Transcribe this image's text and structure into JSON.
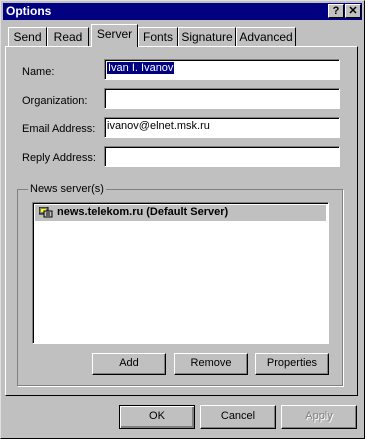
{
  "window": {
    "title": "Options",
    "help_btn": "?",
    "close_btn": "✕"
  },
  "tabs": [
    "Send",
    "Read",
    "Server",
    "Fonts",
    "Signature",
    "Advanced"
  ],
  "fields": {
    "name": {
      "label": "Name:",
      "value": "Ivan I. Ivanov"
    },
    "organization": {
      "label": "Organization:",
      "value": ""
    },
    "email": {
      "label": "Email Address:",
      "value": "ivanov@elnet.msk.ru"
    },
    "reply": {
      "label": "Reply Address:",
      "value": ""
    }
  },
  "news_servers": {
    "group_label": "News server(s)",
    "items": [
      "news.telekom.ru (Default Server)"
    ],
    "buttons": {
      "add": "Add",
      "remove": "Remove",
      "properties": "Properties"
    }
  },
  "footer": {
    "ok": "OK",
    "cancel": "Cancel",
    "apply": "Apply"
  }
}
